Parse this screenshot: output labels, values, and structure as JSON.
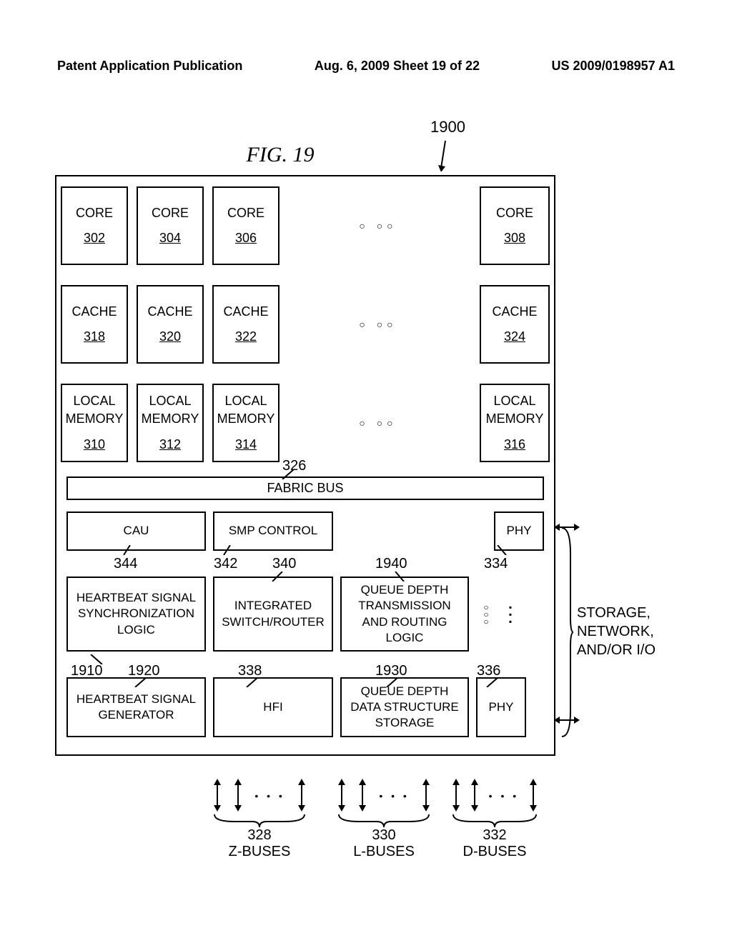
{
  "header": {
    "left": "Patent Application Publication",
    "center": "Aug. 6, 2009  Sheet 19 of 22",
    "right": "US 2009/0198957 A1"
  },
  "figure": {
    "title": "FIG. 19",
    "overall_ref": "1900",
    "rows": {
      "cores": [
        {
          "label": "CORE",
          "ref": "302"
        },
        {
          "label": "CORE",
          "ref": "304"
        },
        {
          "label": "CORE",
          "ref": "306"
        },
        {
          "label": "CORE",
          "ref": "308"
        }
      ],
      "caches": [
        {
          "label": "CACHE",
          "ref": "318"
        },
        {
          "label": "CACHE",
          "ref": "320"
        },
        {
          "label": "CACHE",
          "ref": "322"
        },
        {
          "label": "CACHE",
          "ref": "324"
        }
      ],
      "mems": [
        {
          "label": "LOCAL MEMORY",
          "ref": "310"
        },
        {
          "label": "LOCAL MEMORY",
          "ref": "312"
        },
        {
          "label": "LOCAL MEMORY",
          "ref": "314"
        },
        {
          "label": "LOCAL MEMORY",
          "ref": "316"
        }
      ]
    },
    "fabric": {
      "label": "FABRIC BUS",
      "ref": "326"
    },
    "lower": {
      "row1": [
        {
          "label": "CAU",
          "ref": "344"
        },
        {
          "label": "SMP CONTROL",
          "ref": "342"
        },
        {
          "label": "PHY",
          "ref": "334"
        }
      ],
      "row2": [
        {
          "label": "HEARTBEAT SIGNAL SYNCHRONIZATION LOGIC",
          "ref": "1910"
        },
        {
          "label": "INTEGRATED SWITCH/ROUTER",
          "ref": "340",
          "ref2": "338"
        },
        {
          "label": "QUEUE DEPTH TRANSMISSION AND ROUTING LOGIC",
          "ref": "1940",
          "ref2": "1930"
        }
      ],
      "row3": [
        {
          "label": "HEARTBEAT SIGNAL GENERATOR",
          "ref": "1920"
        },
        {
          "label": "HFI",
          "ref": ""
        },
        {
          "label": "QUEUE DEPTH DATA STRUCTURE STORAGE",
          "ref": ""
        },
        {
          "label": "PHY",
          "ref": "336"
        }
      ]
    },
    "right_label": "STORAGE, NETWORK, AND/OR I/O",
    "buses": [
      {
        "ref": "328",
        "label": "Z-BUSES"
      },
      {
        "ref": "330",
        "label": "L-BUSES"
      },
      {
        "ref": "332",
        "label": "D-BUSES"
      }
    ]
  }
}
